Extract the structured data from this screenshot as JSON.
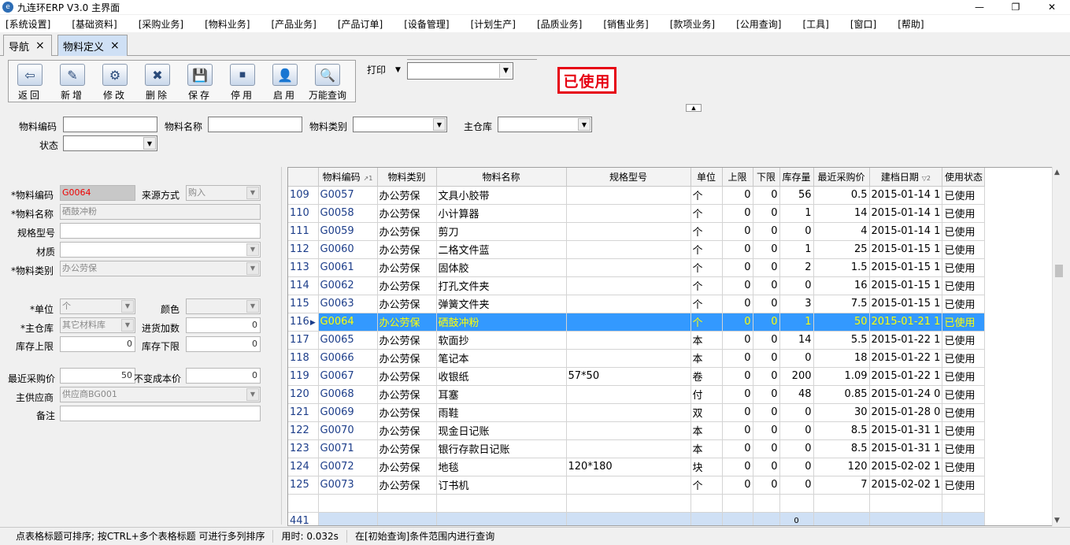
{
  "window": {
    "title": "九连环ERP V3.0 主界面",
    "app_icon": "app-logo-icon",
    "controls": [
      "minimize",
      "maximize",
      "close"
    ]
  },
  "menu": [
    "[系统设置]",
    "[基础资料]",
    "[采购业务]",
    "[物料业务]",
    "[产品业务]",
    "[产品订单]",
    "[设备管理]",
    "[计划生产]",
    "[品质业务]",
    "[销售业务]",
    "[款项业务]",
    "[公用查询]",
    "[工具]",
    "[窗口]",
    "[帮助]"
  ],
  "tabs": [
    {
      "label": "导航",
      "close": "×"
    },
    {
      "label": "物料定义",
      "close": "×"
    }
  ],
  "toolbar": {
    "buttons": [
      {
        "label": "返回",
        "icon": "exit-door-icon"
      },
      {
        "label": "新增",
        "icon": "new-document-icon"
      },
      {
        "label": "修改",
        "icon": "gear-edit-icon"
      },
      {
        "label": "删除",
        "icon": "delete-tools-icon"
      },
      {
        "label": "保存",
        "icon": "save-disk-icon"
      },
      {
        "label": "停用",
        "icon": "stop-icon"
      },
      {
        "label": "启用",
        "icon": "enable-person-icon"
      },
      {
        "label": "万能查询",
        "icon": "magnifier-chart-icon"
      }
    ],
    "print_label": "打印",
    "print_value": ""
  },
  "stamp": "已使用",
  "search": {
    "code_label": "物料编码",
    "name_label": "物料名称",
    "category_label": "物料类别",
    "warehouse_label": "主仓库",
    "status_label": "状态"
  },
  "form": {
    "code_label": "*物料编码",
    "code_value": "G0064",
    "source_label": "来源方式",
    "source_value": "购入",
    "name_label": "*物料名称",
    "name_value": "硒鼓冲粉",
    "spec_label": "规格型号",
    "spec_value": "",
    "material_label": "材质",
    "material_value": "",
    "category_label": "*物料类别",
    "category_value": "办公劳保",
    "unit_label": "*单位",
    "unit_value": "个",
    "color_label": "颜色",
    "color_value": "",
    "warehouse_label": "*主仓库",
    "warehouse_value": "其它材料库",
    "markup_label": "进货加数",
    "markup_value": "0",
    "stock_max_label": "库存上限",
    "stock_max_value": "0",
    "stock_min_label": "库存下限",
    "stock_min_value": "0",
    "last_price_label": "最近采购价",
    "last_price_value": "50",
    "fixed_cost_label": "不变成本价",
    "fixed_cost_value": "0",
    "supplier_label": "主供应商",
    "supplier_value": "供应商BG001",
    "remark_label": "备注",
    "remark_value": ""
  },
  "grid": {
    "columns": [
      "物料编码",
      "物料类别",
      "物料名称",
      "规格型号",
      "单位",
      "上限",
      "下限",
      "库存量",
      "最近采购价",
      "建档日期",
      "使用状态"
    ],
    "sort_indicators": {
      "code": "↗1",
      "date": "▽2"
    },
    "rows": [
      {
        "n": "109",
        "code": "G0057",
        "cat": "办公劳保",
        "name": "文具小胶带",
        "spec": "",
        "unit": "个",
        "max": "0",
        "min": "0",
        "stock": "56",
        "price": "0.5",
        "date": "2015-01-14 1",
        "status": "已使用"
      },
      {
        "n": "110",
        "code": "G0058",
        "cat": "办公劳保",
        "name": "小计算器",
        "spec": "",
        "unit": "个",
        "max": "0",
        "min": "0",
        "stock": "1",
        "price": "14",
        "date": "2015-01-14 1",
        "status": "已使用"
      },
      {
        "n": "111",
        "code": "G0059",
        "cat": "办公劳保",
        "name": "剪刀",
        "spec": "",
        "unit": "个",
        "max": "0",
        "min": "0",
        "stock": "0",
        "price": "4",
        "date": "2015-01-14 1",
        "status": "已使用"
      },
      {
        "n": "112",
        "code": "G0060",
        "cat": "办公劳保",
        "name": "二格文件蓝",
        "spec": "",
        "unit": "个",
        "max": "0",
        "min": "0",
        "stock": "1",
        "price": "25",
        "date": "2015-01-15 1",
        "status": "已使用"
      },
      {
        "n": "113",
        "code": "G0061",
        "cat": "办公劳保",
        "name": "固体胶",
        "spec": "",
        "unit": "个",
        "max": "0",
        "min": "0",
        "stock": "2",
        "price": "1.5",
        "date": "2015-01-15 1",
        "status": "已使用"
      },
      {
        "n": "114",
        "code": "G0062",
        "cat": "办公劳保",
        "name": "打孔文件夹",
        "spec": "",
        "unit": "个",
        "max": "0",
        "min": "0",
        "stock": "0",
        "price": "16",
        "date": "2015-01-15 1",
        "status": "已使用"
      },
      {
        "n": "115",
        "code": "G0063",
        "cat": "办公劳保",
        "name": "弹簧文件夹",
        "spec": "",
        "unit": "个",
        "max": "0",
        "min": "0",
        "stock": "3",
        "price": "7.5",
        "date": "2015-01-15 1",
        "status": "已使用"
      },
      {
        "n": "116",
        "code": "G0064",
        "cat": "办公劳保",
        "name": "硒鼓冲粉",
        "spec": "",
        "unit": "个",
        "max": "0",
        "min": "0",
        "stock": "1",
        "price": "50",
        "date": "2015-01-21 1",
        "status": "已使用",
        "selected": true
      },
      {
        "n": "117",
        "code": "G0065",
        "cat": "办公劳保",
        "name": "软面抄",
        "spec": "",
        "unit": "本",
        "max": "0",
        "min": "0",
        "stock": "14",
        "price": "5.5",
        "date": "2015-01-22 1",
        "status": "已使用"
      },
      {
        "n": "118",
        "code": "G0066",
        "cat": "办公劳保",
        "name": "笔记本",
        "spec": "",
        "unit": "本",
        "max": "0",
        "min": "0",
        "stock": "0",
        "price": "18",
        "date": "2015-01-22 1",
        "status": "已使用"
      },
      {
        "n": "119",
        "code": "G0067",
        "cat": "办公劳保",
        "name": "收银纸",
        "spec": "57*50",
        "unit": "卷",
        "max": "0",
        "min": "0",
        "stock": "200",
        "price": "1.09",
        "date": "2015-01-22 1",
        "status": "已使用"
      },
      {
        "n": "120",
        "code": "G0068",
        "cat": "办公劳保",
        "name": "耳塞",
        "spec": "",
        "unit": "付",
        "max": "0",
        "min": "0",
        "stock": "48",
        "price": "0.85",
        "date": "2015-01-24 0",
        "status": "已使用"
      },
      {
        "n": "121",
        "code": "G0069",
        "cat": "办公劳保",
        "name": "雨鞋",
        "spec": "",
        "unit": "双",
        "max": "0",
        "min": "0",
        "stock": "0",
        "price": "30",
        "date": "2015-01-28 0",
        "status": "已使用"
      },
      {
        "n": "122",
        "code": "G0070",
        "cat": "办公劳保",
        "name": "现金日记账",
        "spec": "",
        "unit": "本",
        "max": "0",
        "min": "0",
        "stock": "0",
        "price": "8.5",
        "date": "2015-01-31 1",
        "status": "已使用"
      },
      {
        "n": "123",
        "code": "G0071",
        "cat": "办公劳保",
        "name": "银行存款日记账",
        "spec": "",
        "unit": "本",
        "max": "0",
        "min": "0",
        "stock": "0",
        "price": "8.5",
        "date": "2015-01-31 1",
        "status": "已使用"
      },
      {
        "n": "124",
        "code": "G0072",
        "cat": "办公劳保",
        "name": "地毯",
        "spec": "120*180",
        "unit": "块",
        "max": "0",
        "min": "0",
        "stock": "0",
        "price": "120",
        "date": "2015-02-02 1",
        "status": "已使用"
      },
      {
        "n": "125",
        "code": "G0073",
        "cat": "办公劳保",
        "name": "订书机",
        "spec": "",
        "unit": "个",
        "max": "0",
        "min": "0",
        "stock": "0",
        "price": "7",
        "date": "2015-02-02 1",
        "status": "已使用"
      }
    ],
    "footer_count": "441",
    "footer_stock_total": "0"
  },
  "status": {
    "hint": "点表格标题可排序; 按CTRL+多个表格标题 可进行多列排序",
    "time": "用时: 0.032s",
    "scope": "在[初始查询]条件范围内进行查询"
  },
  "colors": {
    "selected_row_bg": "#3399ff",
    "selected_row_text": "#ffff00",
    "stamp_red": "#e60012",
    "footer_bg": "#cfe0f5"
  }
}
